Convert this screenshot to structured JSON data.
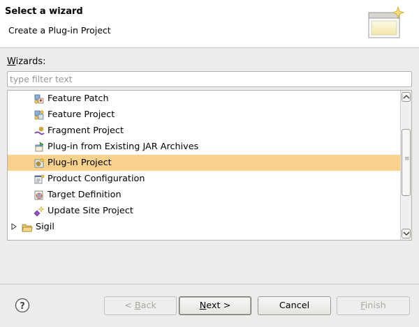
{
  "banner": {
    "title": "Select a wizard",
    "description": "Create a Plug-in Project"
  },
  "wizards": {
    "label_mnemonic": "W",
    "label_rest": "izards:",
    "filter_placeholder": "type filter text",
    "filter_value": ""
  },
  "tree": {
    "items": [
      {
        "label": "Feature Patch",
        "icon": "feature-patch-icon",
        "level": 1
      },
      {
        "label": "Feature Project",
        "icon": "feature-project-icon",
        "level": 1
      },
      {
        "label": "Fragment Project",
        "icon": "fragment-project-icon",
        "level": 1
      },
      {
        "label": "Plug-in from Existing JAR Archives",
        "icon": "plugin-jar-icon",
        "level": 1
      },
      {
        "label": "Plug-in Project",
        "icon": "plugin-project-icon",
        "level": 1,
        "selected": true
      },
      {
        "label": "Product Configuration",
        "icon": "product-configuration-icon",
        "level": 1
      },
      {
        "label": "Target Definition",
        "icon": "target-definition-icon",
        "level": 1
      },
      {
        "label": "Update Site Project",
        "icon": "update-site-icon",
        "level": 1
      },
      {
        "label": "Sigil",
        "icon": "folder-icon",
        "level": 0,
        "expandable": true
      }
    ],
    "scroll_position": 0.45,
    "selection_color": "#f8d28c"
  },
  "buttons": {
    "back": {
      "mnemonic": "B",
      "prefix": "< ",
      "rest": "ack"
    },
    "next": {
      "mnemonic": "N",
      "prefix": "",
      "rest": "ext >"
    },
    "cancel": {
      "label": "Cancel"
    },
    "finish": {
      "mnemonic": "F",
      "prefix": "",
      "rest": "inish"
    }
  }
}
